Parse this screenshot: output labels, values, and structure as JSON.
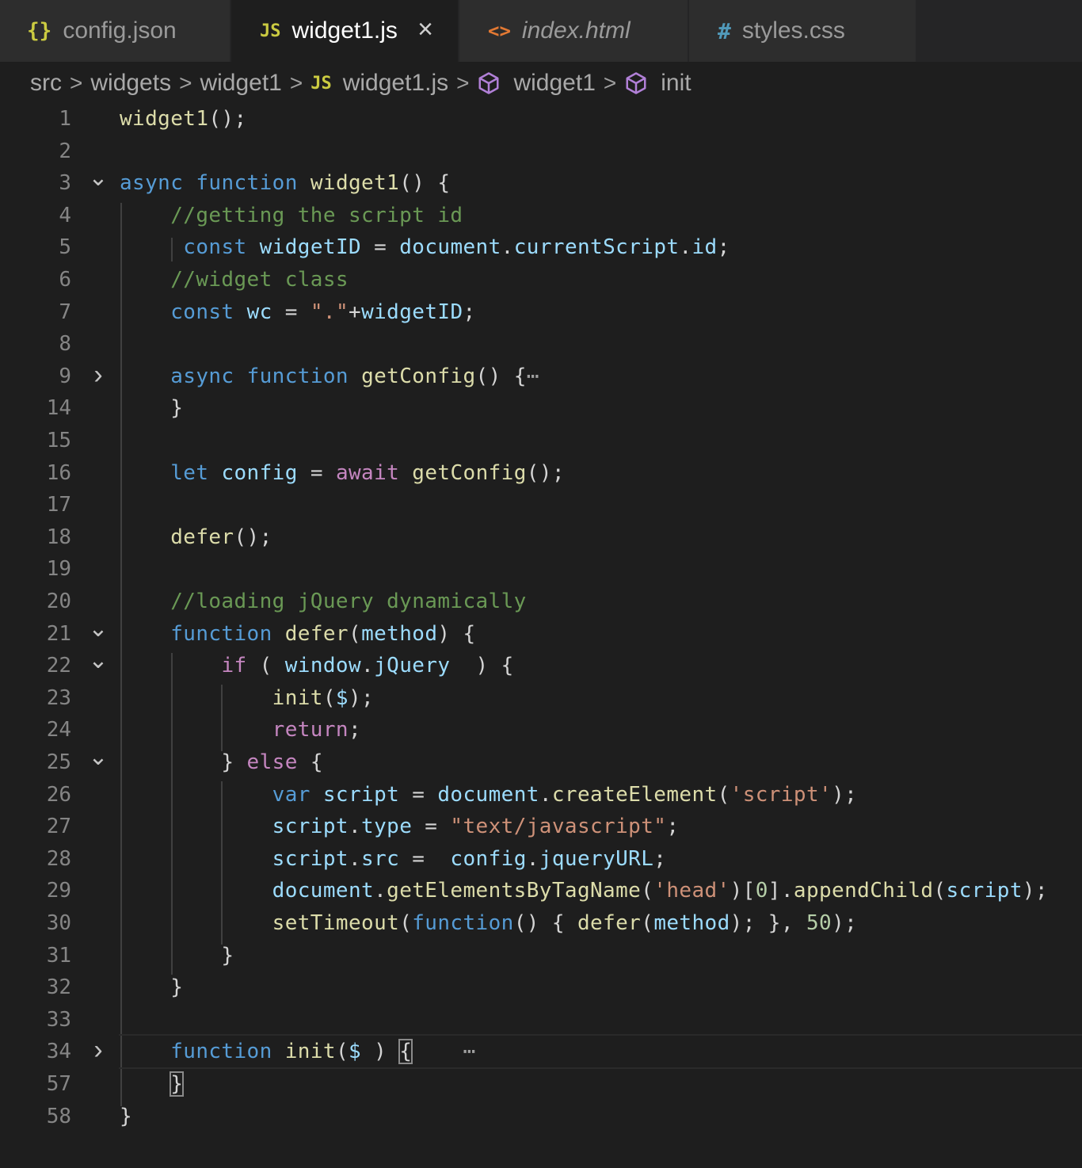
{
  "tabs": [
    {
      "label": "config.json",
      "icon": "{}",
      "icon_name": "json-braces-icon",
      "active": false,
      "italic": false
    },
    {
      "label": "widget1.js",
      "icon": "JS",
      "icon_name": "javascript-icon",
      "active": true,
      "italic": false,
      "close": "×"
    },
    {
      "label": "index.html",
      "icon": "<>",
      "icon_name": "html-icon",
      "active": false,
      "italic": true
    },
    {
      "label": "styles.css",
      "icon": "#",
      "icon_name": "css-hash-icon",
      "active": false,
      "italic": false
    }
  ],
  "breadcrumb": {
    "items": [
      "src",
      "widgets",
      "widget1",
      "widget1.js",
      "widget1",
      "init"
    ],
    "separator": ">",
    "js_icon": "JS"
  },
  "colors": {
    "background": "#1e1e1e",
    "keyword": "#569cd6",
    "control": "#c586c0",
    "function": "#dcdcaa",
    "variable": "#9cdcfe",
    "string": "#ce9178",
    "comment": "#6a9955",
    "number": "#b5cea8"
  },
  "editor": {
    "current_line": "34",
    "lines": [
      {
        "num": "1",
        "fold": "",
        "tokens": [
          [
            "fn",
            "widget1"
          ],
          [
            "",
            "();"
          ]
        ]
      },
      {
        "num": "2",
        "fold": "",
        "tokens": []
      },
      {
        "num": "3",
        "fold": "down",
        "tokens": [
          [
            "kw",
            "async"
          ],
          [
            "",
            " "
          ],
          [
            "kw",
            "function"
          ],
          [
            "",
            " "
          ],
          [
            "fn",
            "widget1"
          ],
          [
            "",
            "() {"
          ]
        ]
      },
      {
        "num": "4",
        "fold": "",
        "tokens": [
          [
            "",
            "    "
          ],
          [
            "com",
            "//getting the script id"
          ]
        ]
      },
      {
        "num": "5",
        "fold": "",
        "tokens": [
          [
            "",
            "     "
          ],
          [
            "kw",
            "const"
          ],
          [
            "",
            " "
          ],
          [
            "var",
            "widgetID"
          ],
          [
            "",
            " = "
          ],
          [
            "var",
            "document"
          ],
          [
            "",
            "."
          ],
          [
            "var",
            "currentScript"
          ],
          [
            "",
            "."
          ],
          [
            "var",
            "id"
          ],
          [
            "",
            ";"
          ]
        ]
      },
      {
        "num": "6",
        "fold": "",
        "tokens": [
          [
            "",
            "    "
          ],
          [
            "com",
            "//widget class"
          ]
        ]
      },
      {
        "num": "7",
        "fold": "",
        "tokens": [
          [
            "",
            "    "
          ],
          [
            "kw",
            "const"
          ],
          [
            "",
            " "
          ],
          [
            "var",
            "wc"
          ],
          [
            "",
            " = "
          ],
          [
            "str",
            "\".\""
          ],
          [
            "",
            "+"
          ],
          [
            "var",
            "widgetID"
          ],
          [
            "",
            ";"
          ]
        ]
      },
      {
        "num": "8",
        "fold": "",
        "tokens": []
      },
      {
        "num": "9",
        "fold": "right",
        "tokens": [
          [
            "",
            "    "
          ],
          [
            "kw",
            "async"
          ],
          [
            "",
            " "
          ],
          [
            "kw",
            "function"
          ],
          [
            "",
            " "
          ],
          [
            "fn",
            "getConfig"
          ],
          [
            "",
            "() {"
          ],
          [
            "ell",
            "⋯"
          ]
        ]
      },
      {
        "num": "14",
        "fold": "",
        "tokens": [
          [
            "",
            "    }"
          ]
        ]
      },
      {
        "num": "15",
        "fold": "",
        "tokens": []
      },
      {
        "num": "16",
        "fold": "",
        "tokens": [
          [
            "",
            "    "
          ],
          [
            "kw",
            "let"
          ],
          [
            "",
            " "
          ],
          [
            "var",
            "config"
          ],
          [
            "",
            " = "
          ],
          [
            "ctl",
            "await"
          ],
          [
            "",
            " "
          ],
          [
            "fn",
            "getConfig"
          ],
          [
            "",
            "();"
          ]
        ]
      },
      {
        "num": "17",
        "fold": "",
        "tokens": []
      },
      {
        "num": "18",
        "fold": "",
        "tokens": [
          [
            "",
            "    "
          ],
          [
            "fn",
            "defer"
          ],
          [
            "",
            "();"
          ]
        ]
      },
      {
        "num": "19",
        "fold": "",
        "tokens": []
      },
      {
        "num": "20",
        "fold": "",
        "tokens": [
          [
            "",
            "    "
          ],
          [
            "com",
            "//loading jQuery dynamically"
          ]
        ]
      },
      {
        "num": "21",
        "fold": "down",
        "tokens": [
          [
            "",
            "    "
          ],
          [
            "kw",
            "function"
          ],
          [
            "",
            " "
          ],
          [
            "fn",
            "defer"
          ],
          [
            "",
            "("
          ],
          [
            "var",
            "method"
          ],
          [
            "",
            ") {"
          ]
        ]
      },
      {
        "num": "22",
        "fold": "down",
        "tokens": [
          [
            "",
            "        "
          ],
          [
            "ctl",
            "if"
          ],
          [
            "",
            " ( "
          ],
          [
            "var",
            "window"
          ],
          [
            "",
            "."
          ],
          [
            "var",
            "jQuery"
          ],
          [
            "",
            "  ) {"
          ]
        ]
      },
      {
        "num": "23",
        "fold": "",
        "tokens": [
          [
            "",
            "            "
          ],
          [
            "fn",
            "init"
          ],
          [
            "",
            "("
          ],
          [
            "var",
            "$"
          ],
          [
            "",
            ");"
          ]
        ]
      },
      {
        "num": "24",
        "fold": "",
        "tokens": [
          [
            "",
            "            "
          ],
          [
            "ctl",
            "return"
          ],
          [
            "",
            ";"
          ]
        ]
      },
      {
        "num": "25",
        "fold": "down",
        "tokens": [
          [
            "",
            "        } "
          ],
          [
            "ctl",
            "else"
          ],
          [
            "",
            " {"
          ]
        ]
      },
      {
        "num": "26",
        "fold": "",
        "tokens": [
          [
            "",
            "            "
          ],
          [
            "kw",
            "var"
          ],
          [
            "",
            " "
          ],
          [
            "var",
            "script"
          ],
          [
            "",
            " = "
          ],
          [
            "var",
            "document"
          ],
          [
            "",
            "."
          ],
          [
            "fn",
            "createElement"
          ],
          [
            "",
            "("
          ],
          [
            "str",
            "'script'"
          ],
          [
            "",
            ");"
          ]
        ]
      },
      {
        "num": "27",
        "fold": "",
        "tokens": [
          [
            "",
            "            "
          ],
          [
            "var",
            "script"
          ],
          [
            "",
            "."
          ],
          [
            "var",
            "type"
          ],
          [
            "",
            " = "
          ],
          [
            "str",
            "\"text/javascript\""
          ],
          [
            "",
            ";"
          ]
        ]
      },
      {
        "num": "28",
        "fold": "",
        "tokens": [
          [
            "",
            "            "
          ],
          [
            "var",
            "script"
          ],
          [
            "",
            "."
          ],
          [
            "var",
            "src"
          ],
          [
            "",
            " =  "
          ],
          [
            "var",
            "config"
          ],
          [
            "",
            "."
          ],
          [
            "var",
            "jqueryURL"
          ],
          [
            "",
            ";"
          ]
        ]
      },
      {
        "num": "29",
        "fold": "",
        "tokens": [
          [
            "",
            "            "
          ],
          [
            "var",
            "document"
          ],
          [
            "",
            "."
          ],
          [
            "fn",
            "getElementsByTagName"
          ],
          [
            "",
            "("
          ],
          [
            "str",
            "'head'"
          ],
          [
            "",
            ")["
          ],
          [
            "num",
            "0"
          ],
          [
            "",
            "]."
          ],
          [
            "fn",
            "appendChild"
          ],
          [
            "",
            "("
          ],
          [
            "var",
            "script"
          ],
          [
            "",
            ");"
          ]
        ]
      },
      {
        "num": "30",
        "fold": "",
        "tokens": [
          [
            "",
            "            "
          ],
          [
            "fn",
            "setTimeout"
          ],
          [
            "",
            "("
          ],
          [
            "kw",
            "function"
          ],
          [
            "",
            "() { "
          ],
          [
            "fn",
            "defer"
          ],
          [
            "",
            "("
          ],
          [
            "var",
            "method"
          ],
          [
            "",
            "); }, "
          ],
          [
            "num",
            "50"
          ],
          [
            "",
            ");"
          ]
        ]
      },
      {
        "num": "31",
        "fold": "",
        "tokens": [
          [
            "",
            "        }"
          ]
        ]
      },
      {
        "num": "32",
        "fold": "",
        "tokens": [
          [
            "",
            "    }"
          ]
        ]
      },
      {
        "num": "33",
        "fold": "",
        "tokens": []
      },
      {
        "num": "34",
        "fold": "right",
        "tokens": [
          [
            "",
            "    "
          ],
          [
            "kw",
            "function"
          ],
          [
            "",
            " "
          ],
          [
            "fn",
            "init"
          ],
          [
            "",
            "("
          ],
          [
            "var",
            "$"
          ],
          [
            "",
            " ) "
          ],
          [
            "match",
            "{"
          ],
          [
            "",
            "    "
          ],
          [
            "ell",
            "⋯"
          ]
        ]
      },
      {
        "num": "57",
        "fold": "",
        "tokens": [
          [
            "",
            "    "
          ],
          [
            "match",
            "}"
          ]
        ]
      },
      {
        "num": "58",
        "fold": "",
        "tokens": [
          [
            "",
            "}"
          ]
        ]
      }
    ]
  }
}
